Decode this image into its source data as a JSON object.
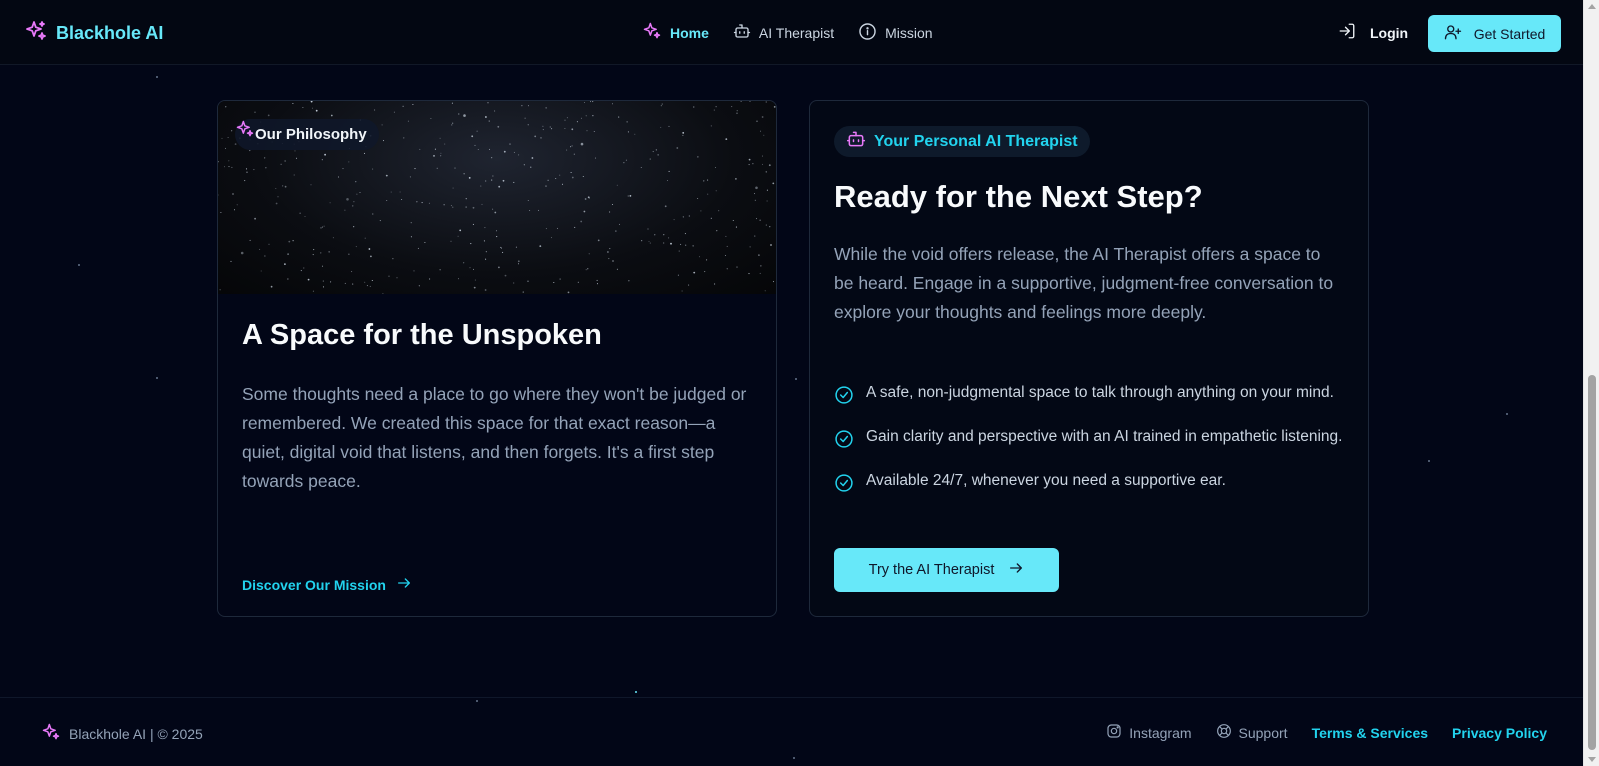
{
  "header": {
    "brand": "Blackhole AI",
    "nav": [
      {
        "label": "Home",
        "icon": "sparkles-icon",
        "active": true
      },
      {
        "label": "AI Therapist",
        "icon": "robot-icon",
        "active": false
      },
      {
        "label": "Mission",
        "icon": "info-icon",
        "active": false
      }
    ],
    "login_label": "Login",
    "get_started_label": "Get Started"
  },
  "left_card": {
    "badge": "Our Philosophy",
    "title": "A Space for the Unspoken",
    "body": "Some thoughts need a place to go where they won't be judged or remembered. We created this space for that exact reason—a quiet, digital void that listens, and then forgets. It's a first step towards peace.",
    "link_label": "Discover Our Mission"
  },
  "right_card": {
    "badge": "Your Personal AI Therapist",
    "title": "Ready for the Next Step?",
    "body": "While the void offers release, the AI Therapist offers a space to be heard. Engage in a supportive, judgment-free conversation to explore your thoughts and feelings more deeply.",
    "features": [
      "A safe, non-judgmental space to talk through anything on your mind.",
      "Gain clarity and perspective with an AI trained in empathetic listening.",
      "Available 24/7, whenever you need a supportive ear."
    ],
    "cta_label": "Try the AI Therapist"
  },
  "footer": {
    "brand": "Blackhole AI | © 2025",
    "links": {
      "instagram": "Instagram",
      "support": "Support",
      "terms": "Terms & Services",
      "privacy": "Privacy Policy"
    }
  },
  "colors": {
    "accent": "#67e8f9",
    "accent_link": "#22d3ee",
    "icon_pink": "#e879f9",
    "background": "#020617"
  }
}
